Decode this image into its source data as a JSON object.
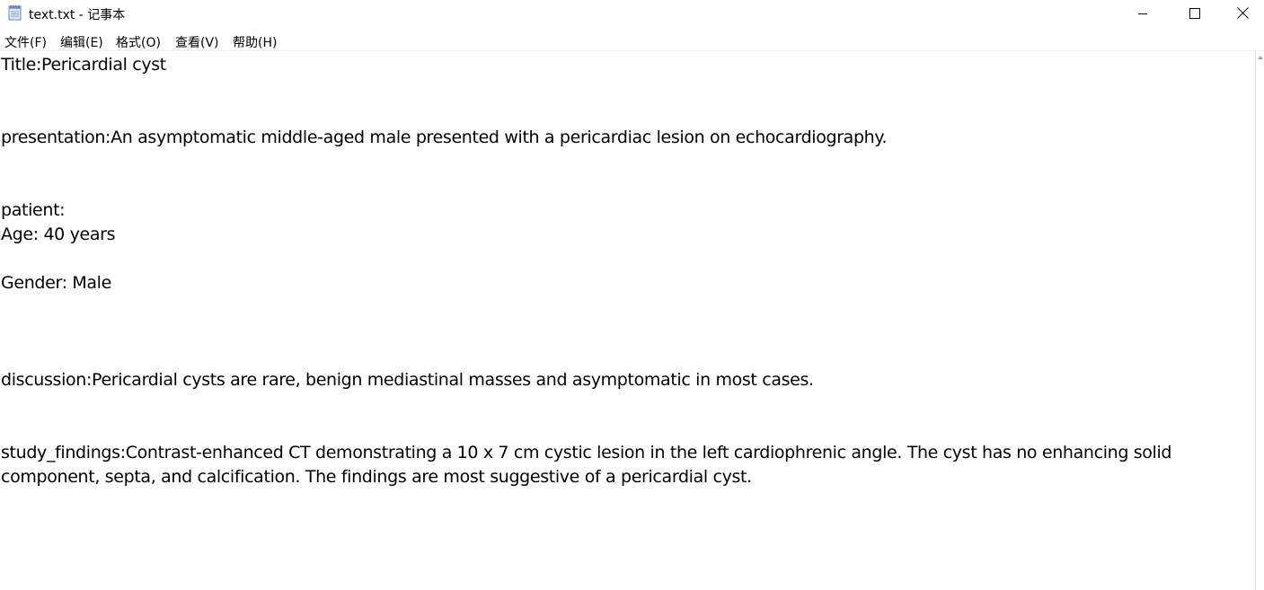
{
  "window": {
    "title": "text.txt - 记事本",
    "icon": "notepad-icon",
    "controls": {
      "minimize_icon": "minimize-icon",
      "maximize_icon": "maximize-icon",
      "close_icon": "close-icon"
    }
  },
  "menu": {
    "items": [
      {
        "label": "文件(F)"
      },
      {
        "label": "编辑(E)"
      },
      {
        "label": "格式(O)"
      },
      {
        "label": "查看(V)"
      },
      {
        "label": "帮助(H)"
      }
    ]
  },
  "document": {
    "lines": [
      "Title:Pericardial cyst",
      "",
      "",
      "presentation:An asymptomatic middle-aged male presented with a pericardiac lesion on echocardiography.",
      "",
      "",
      "patient:",
      "Age: 40 years",
      "",
      "Gender: Male",
      "",
      "",
      "",
      "",
      "discussion:Pericardial cysts are rare, benign mediastinal masses and asymptomatic in most cases.",
      "",
      "",
      "study_findings:Contrast-enhanced CT demonstrating a 10 x 7 cm cystic lesion in the left cardiophrenic angle. The cyst has no enhancing solid",
      "component, septa, and calcification. The findings are most suggestive of a pericardial cyst."
    ]
  },
  "colors": {
    "background": "#ffffff",
    "text": "#000000"
  }
}
